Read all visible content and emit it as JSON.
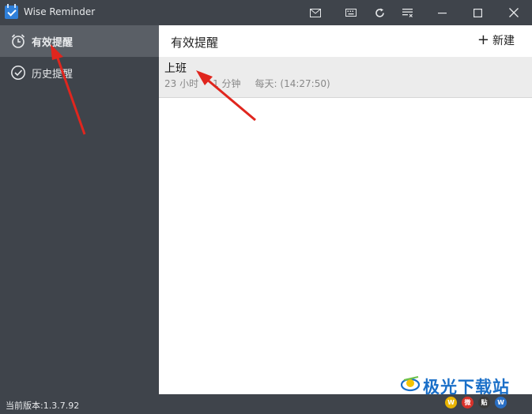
{
  "window": {
    "title": "Wise Reminder",
    "controls": [
      "mail-icon",
      "keyboard-icon",
      "refresh-icon",
      "menu-icon",
      "minimize-icon",
      "maximize-icon",
      "close-icon"
    ]
  },
  "sidebar": {
    "items": [
      {
        "label": "有效提醒",
        "icon": "alarm-clock-icon",
        "active": true
      },
      {
        "label": "历史提醒",
        "icon": "check-circle-icon",
        "active": false
      }
    ]
  },
  "main": {
    "title": "有效提醒",
    "new_button": {
      "icon": "+",
      "label": "新建"
    },
    "reminders": [
      {
        "title": "上班",
        "countdown_hours": "23 小时",
        "countdown_minutes": "1 分钟",
        "repeat": "每天: (14:27:50)"
      }
    ]
  },
  "status": {
    "version": "当前版本:1.3.7.92"
  },
  "watermark": {
    "text": "极光下载站",
    "badges": [
      "W",
      "微",
      "贴",
      "W"
    ]
  },
  "colors": {
    "chrome": "#3f444b",
    "active_item": "#5a5f66",
    "row_bg": "#ececec",
    "annotation_arrow": "#e0261e",
    "watermark_blue": "#1a6fc8"
  }
}
